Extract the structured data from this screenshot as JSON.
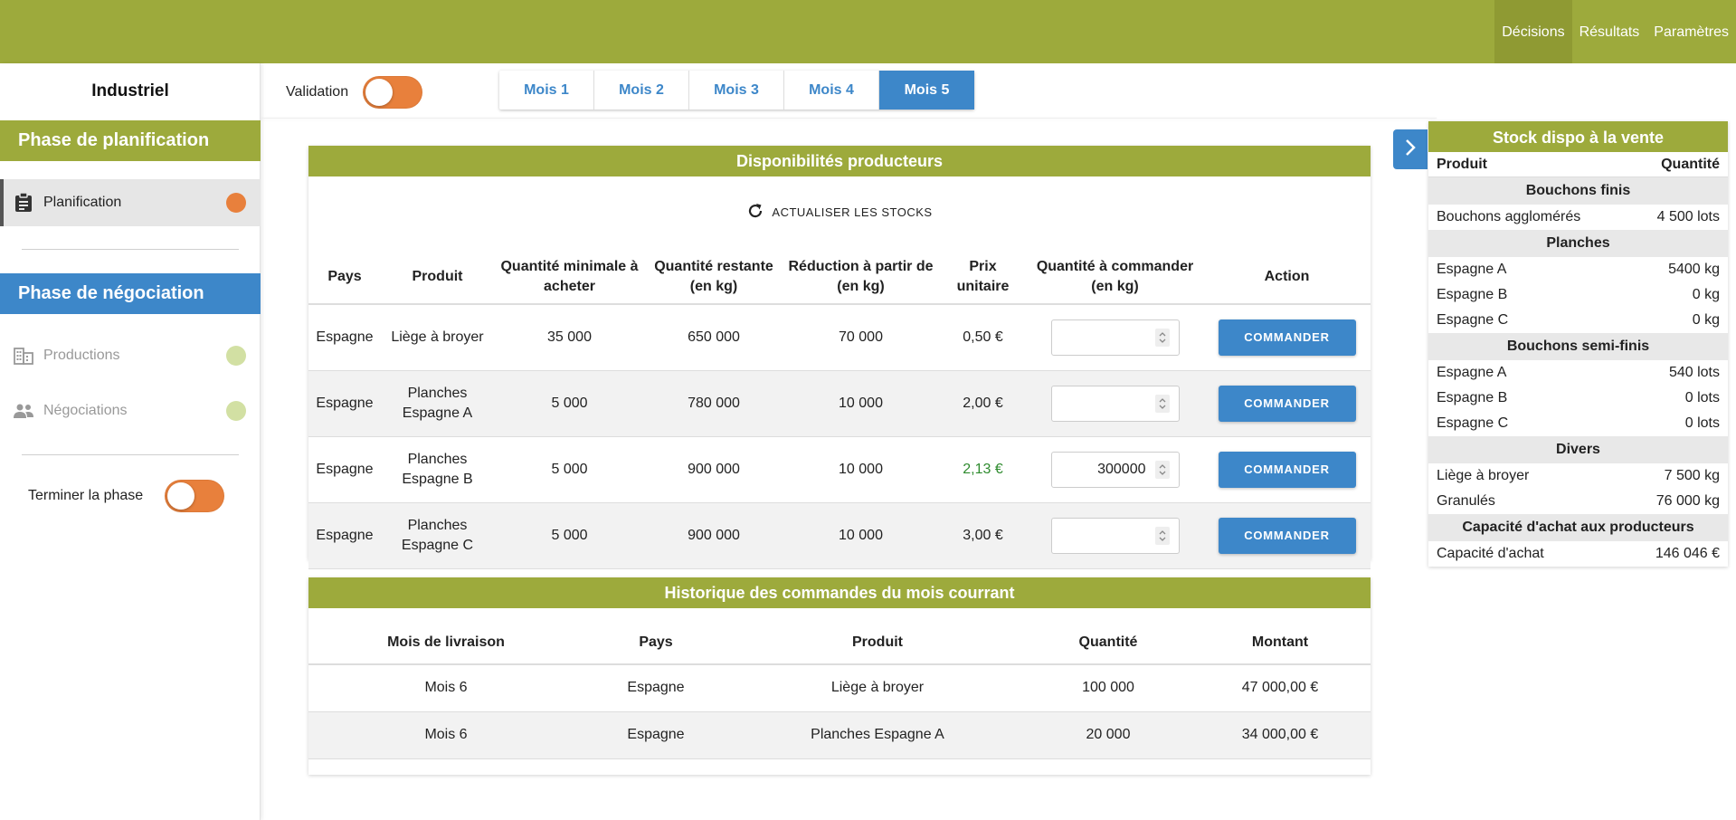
{
  "topnav": {
    "items": [
      "Décisions",
      "Résultats",
      "Paramètres"
    ],
    "active_index": 0
  },
  "sidebar": {
    "title": "Industriel",
    "phase_planning": "Phase de planification",
    "planning_item": "Planification",
    "phase_negotiation": "Phase de négociation",
    "productions_item": "Productions",
    "negotiations_item": "Négociations",
    "end_phase_label": "Terminer la phase",
    "status_colors": {
      "planning": "#e8803c",
      "productions": "#d2e0a3",
      "negotiations": "#d2e0a3"
    }
  },
  "validation_label": "Validation",
  "month_tabs": [
    "Mois 1",
    "Mois 2",
    "Mois 3",
    "Mois 4",
    "Mois 5"
  ],
  "active_month": 4,
  "producers": {
    "title": "Disponibilités producteurs",
    "refresh_label": "ACTUALISER LES STOCKS",
    "headers": [
      "Pays",
      "Produit",
      "Quantité minimale à acheter",
      "Quantité restante (en kg)",
      "Réduction à partir de (en kg)",
      "Prix unitaire",
      "Quantité à commander (en kg)",
      "Action"
    ],
    "rows": [
      {
        "pays": "Espagne",
        "produit": "Liège à broyer",
        "min": "35 000",
        "restante": "650 000",
        "reduction": "70 000",
        "prix": "0,50 €",
        "qty": "",
        "action": "COMMANDER"
      },
      {
        "pays": "Espagne",
        "produit": "Planches Espagne A",
        "min": "5 000",
        "restante": "780 000",
        "reduction": "10 000",
        "prix": "2,00 €",
        "qty": "",
        "action": "COMMANDER"
      },
      {
        "pays": "Espagne",
        "produit": "Planches Espagne B",
        "min": "5 000",
        "restante": "900 000",
        "reduction": "10 000",
        "prix": "2,13 €",
        "qty": "300000",
        "action": "COMMANDER"
      },
      {
        "pays": "Espagne",
        "produit": "Planches Espagne C",
        "min": "5 000",
        "restante": "900 000",
        "reduction": "10 000",
        "prix": "3,00 €",
        "qty": "",
        "action": "COMMANDER"
      }
    ]
  },
  "history": {
    "title": "Historique des commandes du mois courrant",
    "headers": [
      "Mois de livraison",
      "Pays",
      "Produit",
      "Quantité",
      "Montant"
    ],
    "rows": [
      [
        "Mois 6",
        "Espagne",
        "Liège à broyer",
        "100 000",
        "47 000,00 €"
      ],
      [
        "Mois 6",
        "Espagne",
        "Planches Espagne A",
        "20 000",
        "34 000,00 €"
      ]
    ]
  },
  "stock": {
    "title": "Stock dispo à la vente",
    "col_product": "Produit",
    "col_quantity": "Quantité",
    "sections": [
      {
        "name": "Bouchons finis",
        "rows": [
          [
            "Bouchons agglomérés",
            "4 500 lots"
          ]
        ]
      },
      {
        "name": "Planches",
        "rows": [
          [
            "Espagne A",
            "5400 kg"
          ],
          [
            "Espagne B",
            "0 kg"
          ],
          [
            "Espagne C",
            "0 kg"
          ]
        ]
      },
      {
        "name": "Bouchons semi-finis",
        "rows": [
          [
            "Espagne A",
            "540 lots"
          ],
          [
            "Espagne B",
            "0 lots"
          ],
          [
            "Espagne C",
            "0 lots"
          ]
        ]
      },
      {
        "name": "Divers",
        "rows": [
          [
            "Liège à broyer",
            "7 500 kg"
          ],
          [
            "Granulés",
            "76 000 kg"
          ]
        ]
      },
      {
        "name": "Capacité d'achat aux producteurs",
        "rows": [
          [
            "Capacité d'achat",
            "146 046 €"
          ]
        ]
      }
    ]
  }
}
